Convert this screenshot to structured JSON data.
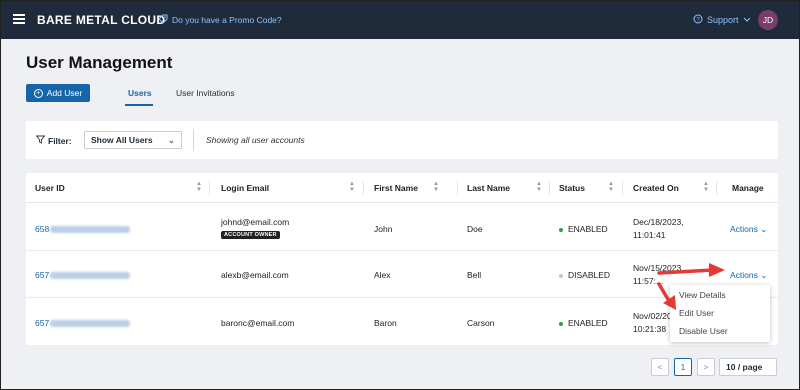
{
  "header": {
    "brand": "BARE METAL CLOUD",
    "promo": "Do you have a Promo Code?",
    "support": "Support",
    "avatar_initials": "JD"
  },
  "page": {
    "title": "User Management",
    "add_user": "Add User",
    "tabs": [
      {
        "label": "Users",
        "active": true
      },
      {
        "label": "User Invitations",
        "active": false
      }
    ]
  },
  "filter": {
    "label": "Filter:",
    "selected": "Show All Users",
    "note": "Showing all user accounts"
  },
  "table": {
    "columns": [
      "User ID",
      "Login Email",
      "First Name",
      "Last Name",
      "Status",
      "Created On",
      "Manage"
    ],
    "rows": [
      {
        "id_prefix": "658",
        "email": "johnd@email.com",
        "badge": "ACCOUNT OWNER",
        "first": "John",
        "last": "Doe",
        "status": "ENABLED",
        "created_date": "Dec/18/2023,",
        "created_time": "11:01:41",
        "manage": "Actions"
      },
      {
        "id_prefix": "657",
        "email": "alexb@email.com",
        "badge": "",
        "first": "Alex",
        "last": "Bell",
        "status": "DISABLED",
        "created_date": "Nov/15/2023,",
        "created_time": "11:57:...",
        "manage": "Actions"
      },
      {
        "id_prefix": "657",
        "email": "baronc@email.com",
        "badge": "",
        "first": "Baron",
        "last": "Carson",
        "status": "ENABLED",
        "created_date": "Nov/02/20...",
        "created_time": "10:21:38",
        "manage": "Actions"
      }
    ]
  },
  "dropdown": {
    "items": [
      "View Details",
      "Edit User",
      "Disable User"
    ]
  },
  "pagination": {
    "prev": "<",
    "current": "1",
    "next": ">",
    "page_size": "10 / page"
  },
  "colors": {
    "topbar": "#1f2a3a",
    "accent": "#1565a8",
    "enabled": "#2e9e44",
    "disabled": "#c4c8cc",
    "arrow": "#e53935"
  }
}
